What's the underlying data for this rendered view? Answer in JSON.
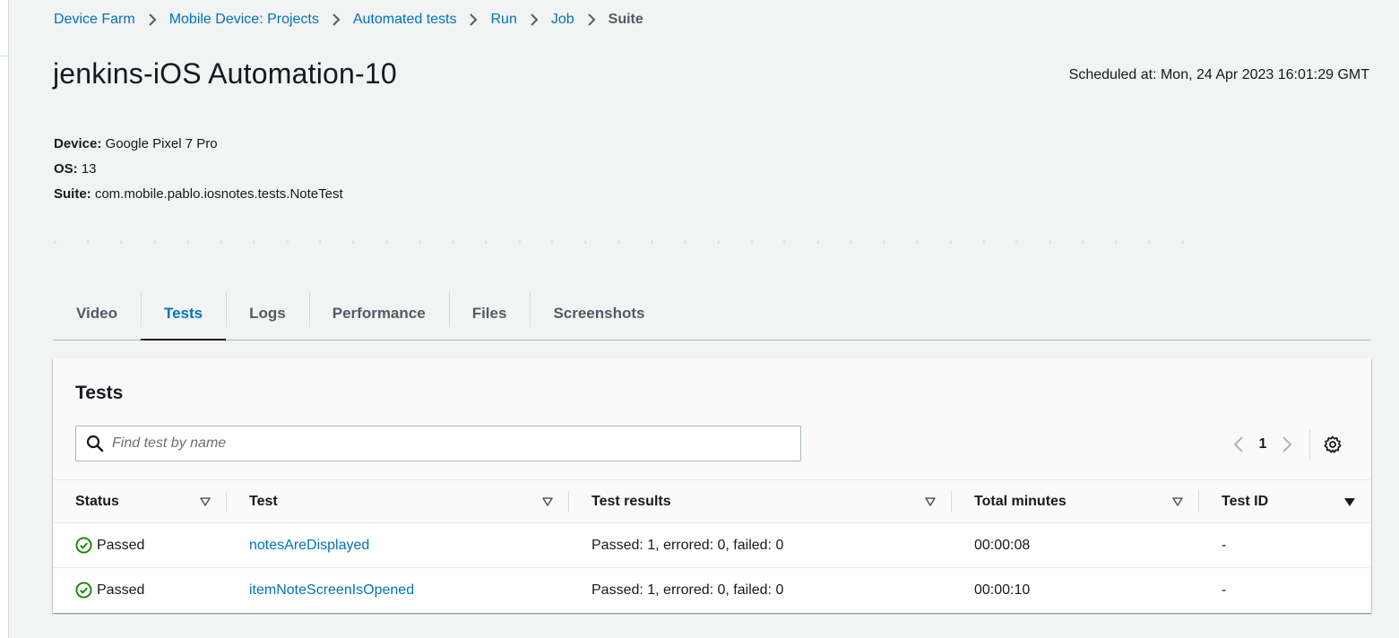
{
  "breadcrumbs": [
    {
      "label": "Device Farm"
    },
    {
      "label": "Mobile Device: Projects"
    },
    {
      "label": "Automated tests"
    },
    {
      "label": "Run"
    },
    {
      "label": "Job"
    }
  ],
  "breadcrumb_current": "Suite",
  "page": {
    "title": "jenkins-iOS Automation-10",
    "scheduled": "Scheduled at: Mon, 24 Apr 2023 16:01:29 GMT"
  },
  "details": {
    "device_label": "Device:",
    "device_value": "Google Pixel 7 Pro",
    "os_label": "OS:",
    "os_value": "13",
    "suite_label": "Suite:",
    "suite_value": "com.mobile.pablo.iosnotes.tests.NoteTest"
  },
  "tabs": [
    {
      "label": "Video",
      "active": false
    },
    {
      "label": "Tests",
      "active": true
    },
    {
      "label": "Logs",
      "active": false
    },
    {
      "label": "Performance",
      "active": false
    },
    {
      "label": "Files",
      "active": false
    },
    {
      "label": "Screenshots",
      "active": false
    }
  ],
  "tests_panel": {
    "title": "Tests",
    "search_placeholder": "Find test by name",
    "current_page": "1",
    "columns": [
      "Status",
      "Test",
      "Test results",
      "Total minutes",
      "Test ID"
    ],
    "rows": [
      {
        "status": "Passed",
        "test": "notesAreDisplayed",
        "results": "Passed: 1, errored: 0, failed: 0",
        "minutes": "00:00:08",
        "test_id": "-"
      },
      {
        "status": "Passed",
        "test": "itemNoteScreenIsOpened",
        "results": "Passed: 1, errored: 0, failed: 0",
        "minutes": "00:00:10",
        "test_id": "-"
      }
    ]
  },
  "colors": {
    "link": "#0073bb",
    "success": "#1d8102",
    "text": "#16191f",
    "background": "#f2f3f3"
  },
  "icons": [
    "chevron-right-icon",
    "search-icon",
    "chevron-left-icon",
    "gear-icon",
    "sort-icon",
    "sort-descending-icon",
    "check-circle-icon"
  ]
}
